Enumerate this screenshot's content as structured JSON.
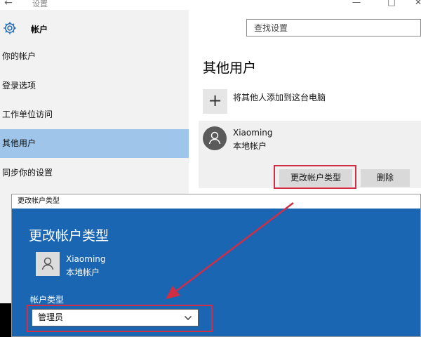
{
  "window": {
    "title": "设置",
    "back_glyph": "←",
    "minimize_glyph": "—",
    "maximize_glyph": "□",
    "close_glyph": "✕"
  },
  "header": {
    "section_title": "帐户",
    "search_placeholder": "查找设置"
  },
  "sidebar": {
    "items": [
      {
        "label": "你的帐户"
      },
      {
        "label": "登录选项"
      },
      {
        "label": "工作单位访问"
      },
      {
        "label": "其他用户"
      },
      {
        "label": "同步你的设置"
      }
    ],
    "selected_index": 3
  },
  "main": {
    "title": "其他用户",
    "add_glyph": "+",
    "add_user_label": "将其他人添加到这台电脑",
    "account": {
      "name": "Xiaoming",
      "type": "本地帐户"
    },
    "change_type_button": "更改帐户类型",
    "delete_button": "删除"
  },
  "dialog": {
    "window_title": "更改帐户类型",
    "heading": "更改帐户类型",
    "account_name": "Xiaoming",
    "account_type": "本地帐户",
    "type_label": "帐户类型",
    "selected_type": "管理员"
  },
  "colors": {
    "accent_blue": "#1a66b3",
    "selected_nav": "#9fc6ea",
    "highlight_red": "#cf2e45"
  }
}
